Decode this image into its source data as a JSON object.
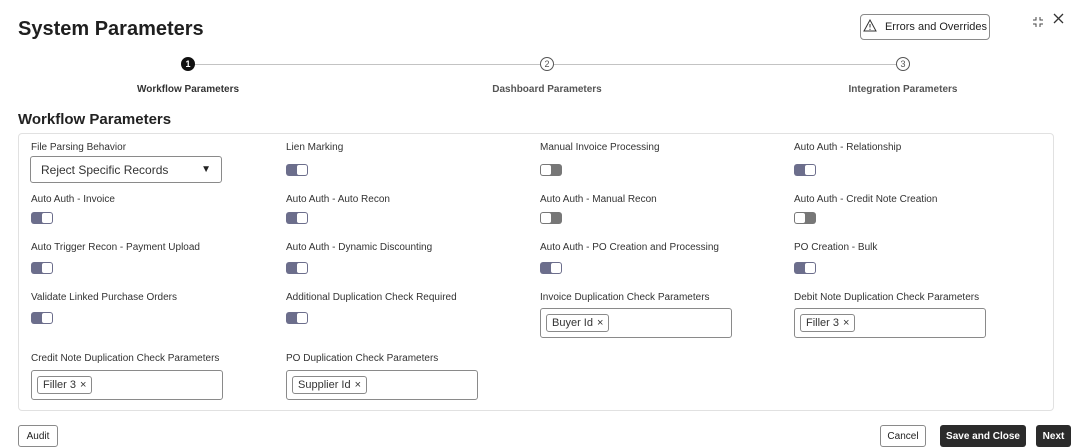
{
  "header": {
    "title": "System Parameters",
    "errors_button": "Errors and Overrides",
    "warning_icon": "warning-triangle-icon",
    "collapse_icon": "collapse-icon",
    "close_icon": "close-icon"
  },
  "steps": [
    {
      "number": "1",
      "label": "Workflow Parameters",
      "active": true
    },
    {
      "number": "2",
      "label": "Dashboard Parameters",
      "active": false
    },
    {
      "number": "3",
      "label": "Integration Parameters",
      "active": false
    }
  ],
  "section_title": "Workflow Parameters",
  "fields": {
    "file_parsing": {
      "label": "File Parsing Behavior",
      "value": "Reject Specific Records"
    },
    "lien_marking": {
      "label": "Lien Marking",
      "on": true
    },
    "manual_invoice": {
      "label": "Manual Invoice Processing",
      "on": false
    },
    "auto_auth_relationship": {
      "label": "Auto Auth - Relationship",
      "on": true
    },
    "auto_auth_invoice": {
      "label": "Auto Auth - Invoice",
      "on": true
    },
    "auto_auth_auto_recon": {
      "label": "Auto Auth - Auto Recon",
      "on": true
    },
    "auto_auth_manual_recon": {
      "label": "Auto Auth - Manual Recon",
      "on": false
    },
    "auto_auth_credit_note": {
      "label": "Auto Auth - Credit Note Creation",
      "on": false
    },
    "auto_trigger_recon": {
      "label": "Auto Trigger Recon - Payment Upload",
      "on": true
    },
    "auto_auth_dynamic": {
      "label": "Auto Auth - Dynamic Discounting",
      "on": true
    },
    "auto_auth_po": {
      "label": "Auto Auth - PO Creation and Processing",
      "on": true
    },
    "po_creation_bulk": {
      "label": "PO Creation - Bulk",
      "on": true
    },
    "validate_linked_po": {
      "label": "Validate Linked Purchase Orders",
      "on": true
    },
    "additional_dup_check": {
      "label": "Additional Duplication Check Required",
      "on": true
    },
    "invoice_dup_params": {
      "label": "Invoice Duplication Check Parameters",
      "chip": "Buyer Id"
    },
    "debit_note_dup_params": {
      "label": "Debit Note Duplication Check Parameters",
      "chip": "Filler 3"
    },
    "credit_note_dup_params": {
      "label": "Credit Note Duplication Check Parameters",
      "chip": "Filler 3"
    },
    "po_dup_params": {
      "label": "PO Duplication Check Parameters",
      "chip": "Supplier Id"
    }
  },
  "chip_remove": "×",
  "footer": {
    "audit": "Audit",
    "cancel": "Cancel",
    "save_close": "Save and Close",
    "next": "Next"
  }
}
